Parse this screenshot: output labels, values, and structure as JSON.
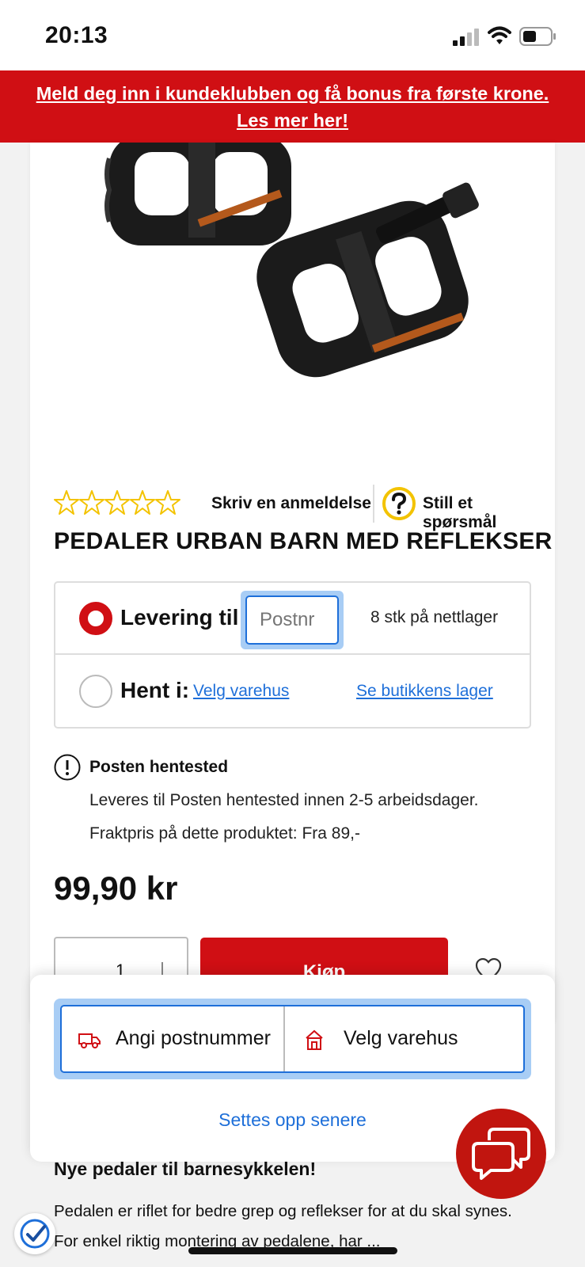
{
  "status_bar": {
    "time": "20:13"
  },
  "promo": {
    "line1": "Meld deg inn i kundeklubben og få bonus fra første krone.",
    "line2": "Les mer her!"
  },
  "product": {
    "review_link": "Skriv en anmeldelse",
    "question_link": "Still et spørsmål",
    "rating_stars": 0,
    "title": "PEDALER URBAN BARN MED REFLEKSER",
    "price": "99,90 kr"
  },
  "delivery": {
    "delivery_label": "Levering til:",
    "postnr_placeholder": "Postnr",
    "stock_online": "8 stk på nettlager",
    "pickup_label": "Hent i:",
    "choose_store_link": "Velg varehus",
    "store_stock_link": "Se butikkens lager",
    "selected": "delivery"
  },
  "shipping_info": {
    "title": "Posten hentested",
    "line1": "Leveres til Posten hentested innen 2-5 arbeidsdager.",
    "line2": "Fraktpris på dette produktet: Fra 89,-"
  },
  "cart": {
    "quantity": "1",
    "buy_label": "Kjøp"
  },
  "sheet": {
    "postcode_button": "Angi postnummer",
    "store_button": "Velg varehus",
    "later_link": "Settes opp senere"
  },
  "description": {
    "title": "Nye pedaler til barnesykkelen!",
    "line1": "Pedalen er riflet for bedre grep og reflekser for at du skal synes.",
    "line2": "For enkel riktig montering av pedalene, har ..."
  },
  "colors": {
    "brand_red": "#d00f14",
    "link_blue": "#1e6fd9",
    "focus_blue": "#a8cdf5",
    "star_yellow": "#f3c300"
  },
  "icons": {
    "signal": "signal-icon",
    "wifi": "wifi-icon",
    "battery": "battery-icon",
    "question": "question-icon",
    "info": "info-icon",
    "truck": "truck-icon",
    "store": "store-icon",
    "heart": "heart-icon",
    "chat": "chat-icon",
    "badge": "trust-badge-icon"
  }
}
